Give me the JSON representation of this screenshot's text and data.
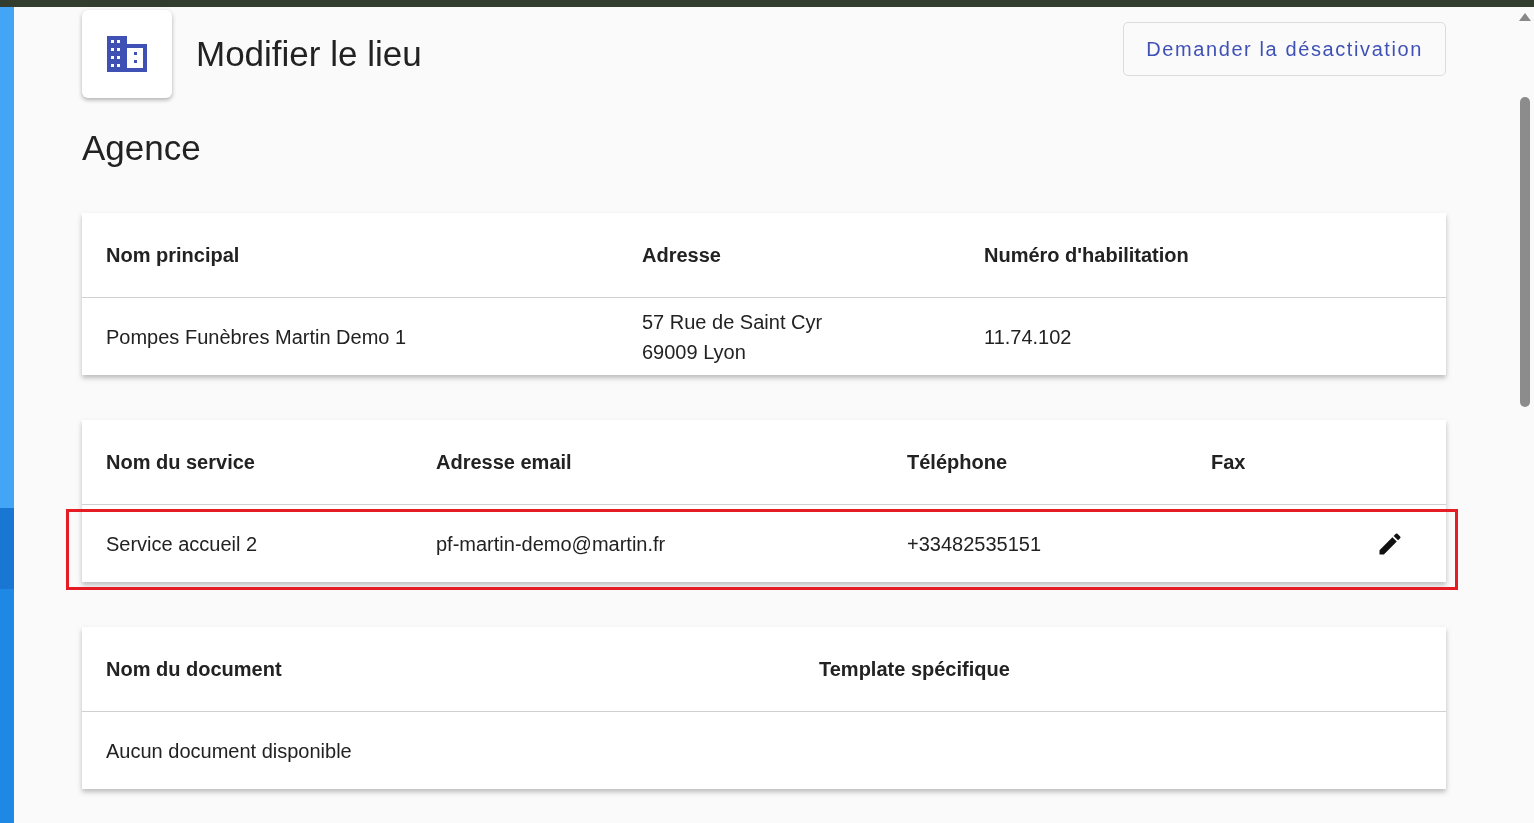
{
  "header": {
    "title": "Modifier le lieu",
    "action_button": "Demander la désactivation"
  },
  "section_title": "Agence",
  "agency_table": {
    "columns": [
      "Nom principal",
      "Adresse",
      "Numéro d'habilitation"
    ],
    "rows": [
      {
        "cells": [
          [
            "Pompes Funèbres Martin Demo 1"
          ],
          [
            "57 Rue de Saint Cyr",
            "69009 Lyon"
          ],
          [
            "11.74.102"
          ]
        ]
      }
    ]
  },
  "services_table": {
    "columns": [
      "Nom du service",
      "Adresse email",
      "Téléphone",
      "Fax"
    ],
    "rows": [
      {
        "cells": [
          "Service accueil 2",
          "pf-martin-demo@martin.fr",
          "+33482535151",
          ""
        ],
        "highlighted": true
      }
    ]
  },
  "documents_table": {
    "columns": [
      "Nom du document",
      "Template spécifique"
    ],
    "empty_message": "Aucun document disponible"
  }
}
